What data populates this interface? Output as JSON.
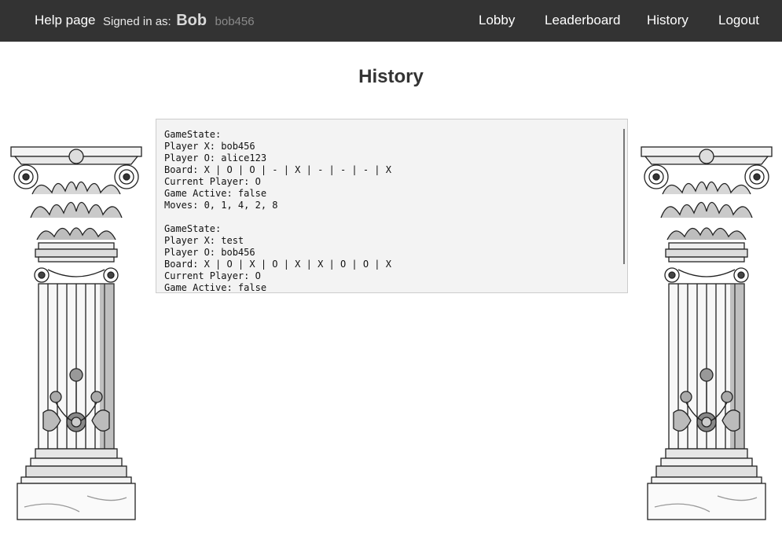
{
  "nav": {
    "help": "Help page",
    "signed_in_label": "Signed in as:",
    "user_name": "Bob",
    "user_handle": "bob456",
    "lobby": "Lobby",
    "leaderboard": "Leaderboard",
    "history": "History",
    "logout": "Logout"
  },
  "page": {
    "title": "History"
  },
  "history": {
    "content": "GameState:\nPlayer X: bob456\nPlayer O: alice123\nBoard: X | O | O | - | X | - | - | - | X\nCurrent Player: O\nGame Active: false\nMoves: 0, 1, 4, 2, 8\n\nGameState:\nPlayer X: test\nPlayer O: bob456\nBoard: X | O | X | O | X | X | O | O | X\nCurrent Player: O\nGame Active: false"
  },
  "decor": {
    "left_image": "corinthian-column-icon",
    "right_image": "corinthian-column-icon"
  }
}
